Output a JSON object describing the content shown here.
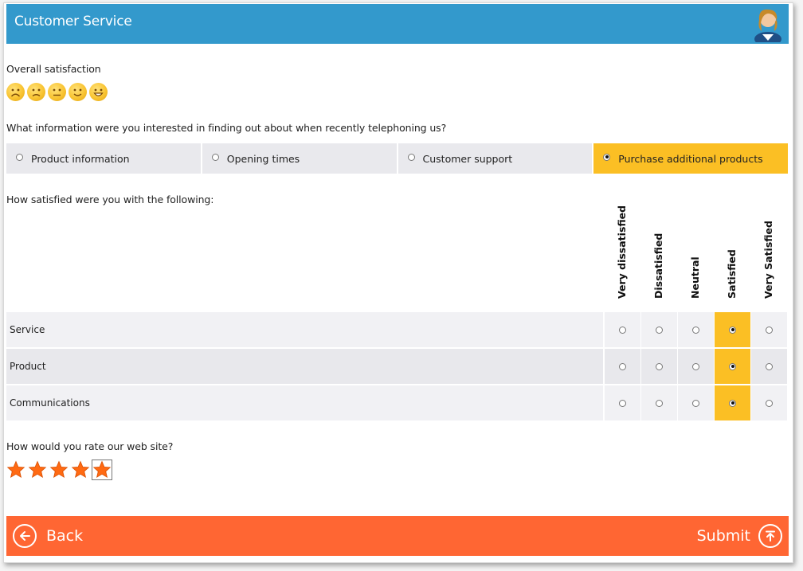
{
  "header": {
    "title": "Customer Service"
  },
  "overall": {
    "label": "Overall satisfaction",
    "smileys": [
      "very-sad",
      "sad",
      "neutral",
      "smile",
      "grin"
    ]
  },
  "info_question": {
    "label": "What information were you interested in finding out about when recently telephoning us?",
    "options": [
      {
        "label": "Product information",
        "selected": false
      },
      {
        "label": "Opening times",
        "selected": false
      },
      {
        "label": "Customer support",
        "selected": false
      },
      {
        "label": "Purchase additional products",
        "selected": true
      }
    ]
  },
  "matrix": {
    "label": "How satisfied were you with the following:",
    "columns": [
      "Very dissatisfied",
      "Dissatisfied",
      "Neutral",
      "Satisfied",
      "Very Satisfied"
    ],
    "rows": [
      {
        "label": "Service",
        "selected_index": 3
      },
      {
        "label": "Product",
        "selected_index": 3
      },
      {
        "label": "Communications",
        "selected_index": 3
      }
    ]
  },
  "rating": {
    "label": "How would you rate our web site?",
    "value": 5,
    "max": 5
  },
  "footer": {
    "back_label": "Back",
    "submit_label": "Submit"
  },
  "colors": {
    "header": "#3399cc",
    "footer": "#ff6633",
    "selected": "#fbbf24",
    "star": "#ff6a13"
  }
}
